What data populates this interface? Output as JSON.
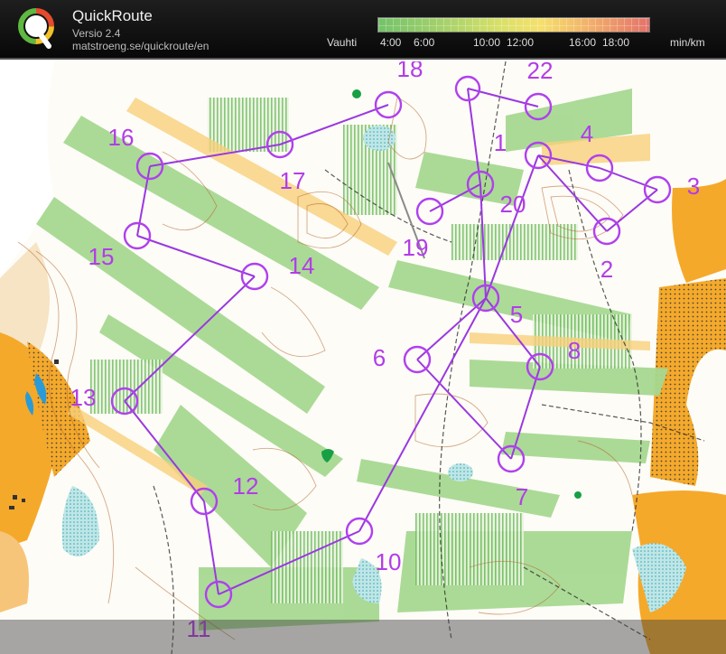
{
  "app": {
    "title": "QuickRoute",
    "version": "Versio 2.4",
    "url": "matstroeng.se/quickroute/en",
    "logo_letter": "Q"
  },
  "pace_legend": {
    "label": "Vauhti",
    "ticks": [
      "4:00",
      "6:00",
      "10:00",
      "12:00",
      "16:00",
      "18:00"
    ],
    "unit": "min/km"
  },
  "colors": {
    "route": "#b040ee",
    "route_line": "#9a38e0",
    "label": "#b23ce8",
    "forest_green": "#8fcf7f",
    "open_yellow": "#f7b43a",
    "contour": "#b5652b"
  },
  "controls": [
    {
      "label": "1"
    },
    {
      "label": "2"
    },
    {
      "label": "3"
    },
    {
      "label": "4"
    },
    {
      "label": "5"
    },
    {
      "label": "6"
    },
    {
      "label": "7"
    },
    {
      "label": "8"
    },
    {
      "label": "10"
    },
    {
      "label": "11"
    },
    {
      "label": "12"
    },
    {
      "label": "13"
    },
    {
      "label": "14"
    },
    {
      "label": "15"
    },
    {
      "label": "16"
    },
    {
      "label": "17"
    },
    {
      "label": "18"
    },
    {
      "label": "19"
    },
    {
      "label": "20"
    },
    {
      "label": "22"
    }
  ]
}
